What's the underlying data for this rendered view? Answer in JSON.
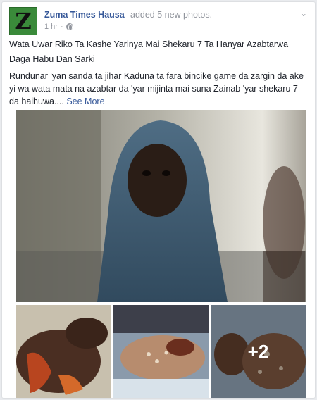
{
  "post": {
    "page_name": "Zuma Times Hausa",
    "action": "added 5 new photos.",
    "timestamp": "1 hr",
    "title": "Wata Uwar Riko Ta Kashe Yarinya Mai Shekaru 7 Ta Hanyar Azabtarwa Daga Habu Dan Sarki",
    "body": "Rundunar 'yan sanda ta jihar Kaduna ta fara bincike game da zargin da ake yi wa wata mata na azabtar da 'yar mijinta mai suna Zainab 'yar shekaru 7 da haihuwa....",
    "see_more": "See More",
    "avatar_glyph": "Z",
    "extra_photos": "+2"
  },
  "icons": {
    "privacy": "globe-icon",
    "menu": "chevron-down-icon"
  },
  "colors": {
    "link": "#365899",
    "meta": "#90949c",
    "avatar_bg": "#3a8a3a"
  }
}
